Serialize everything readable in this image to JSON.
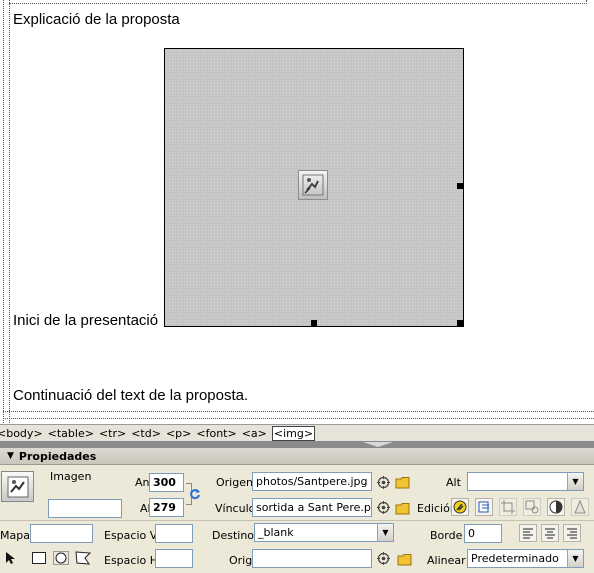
{
  "design": {
    "heading_text": "Explicació de la proposta",
    "inline_text": "Inici de la presentació",
    "continuation_text": "Continuació del text de la proposta."
  },
  "tag_selector": {
    "tags": [
      "<body>",
      "<table>",
      "<tr>",
      "<td>",
      "<p>",
      "<font>",
      "<a>",
      "<img>"
    ],
    "selected": "<img>"
  },
  "properties": {
    "title": "Propiedades",
    "type_label": "Imagen",
    "name_value": "",
    "width_label": "An",
    "width_value": "300",
    "height_label": "Al",
    "height_value": "279",
    "src_label": "Origen",
    "src_value": "photos/Santpere.jpg",
    "link_label": "Vínculo",
    "link_value": "sortida a Sant Pere.pps",
    "alt_label": "Alt",
    "alt_value": "",
    "edit_label": "Edición",
    "map_label": "Mapa",
    "map_value": "",
    "vspace_label": "Espacio V",
    "vspace_value": "",
    "target_label": "Destino",
    "target_value": "_blank",
    "border_label": "Borde",
    "border_value": "0",
    "hspace_label": "Espacio H",
    "hspace_value": "",
    "lowsrc_label": "Orig",
    "lowsrc_value": "",
    "align_label": "Alinear",
    "align_value": "Predeterminado"
  },
  "colors": {
    "panel_bg": "#ece9d8",
    "placeholder_bg": "#c4c4c4",
    "folder_yellow": "#f0c330",
    "refresh_blue": "#2a6fd6"
  }
}
